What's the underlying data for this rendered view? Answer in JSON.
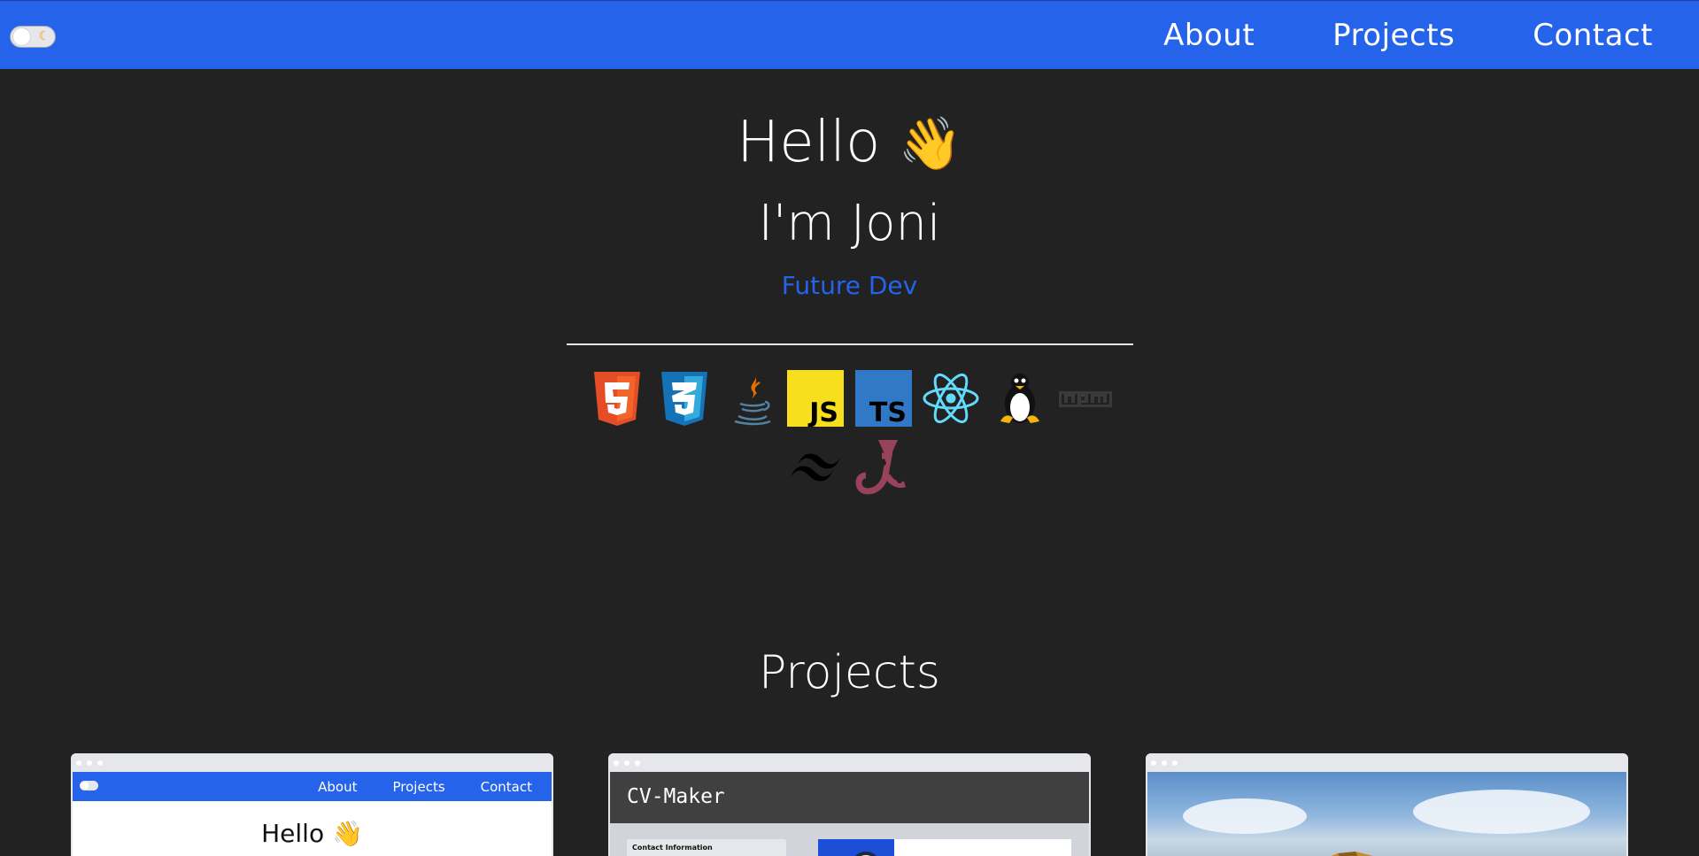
{
  "nav": {
    "theme_toggle_icon": "moon-icon",
    "links": [
      "About",
      "Projects",
      "Contact"
    ]
  },
  "hero": {
    "greeting": "Hello",
    "wave_emoji": "👋",
    "name": "I'm Joni",
    "role": "Future Dev",
    "role_color": "#2563eb"
  },
  "tech_icons": [
    "html5-icon",
    "css3-icon",
    "java-icon",
    "javascript-icon",
    "typescript-icon",
    "react-icon",
    "linux-icon",
    "npm-icon",
    "tailwind-icon",
    "jest-icon"
  ],
  "projects": {
    "title": "Projects",
    "cards": [
      {
        "preview": "portfolio",
        "mini_links": [
          "About",
          "Projects",
          "Contact"
        ],
        "mini_greeting": "Hello",
        "mini_wave": "👋"
      },
      {
        "preview": "cv-maker",
        "header": "CV-Maker",
        "panel_label": "Contact Information"
      },
      {
        "preview": "landscape"
      }
    ]
  },
  "colors": {
    "accent": "#2563eb",
    "background": "#222222"
  }
}
